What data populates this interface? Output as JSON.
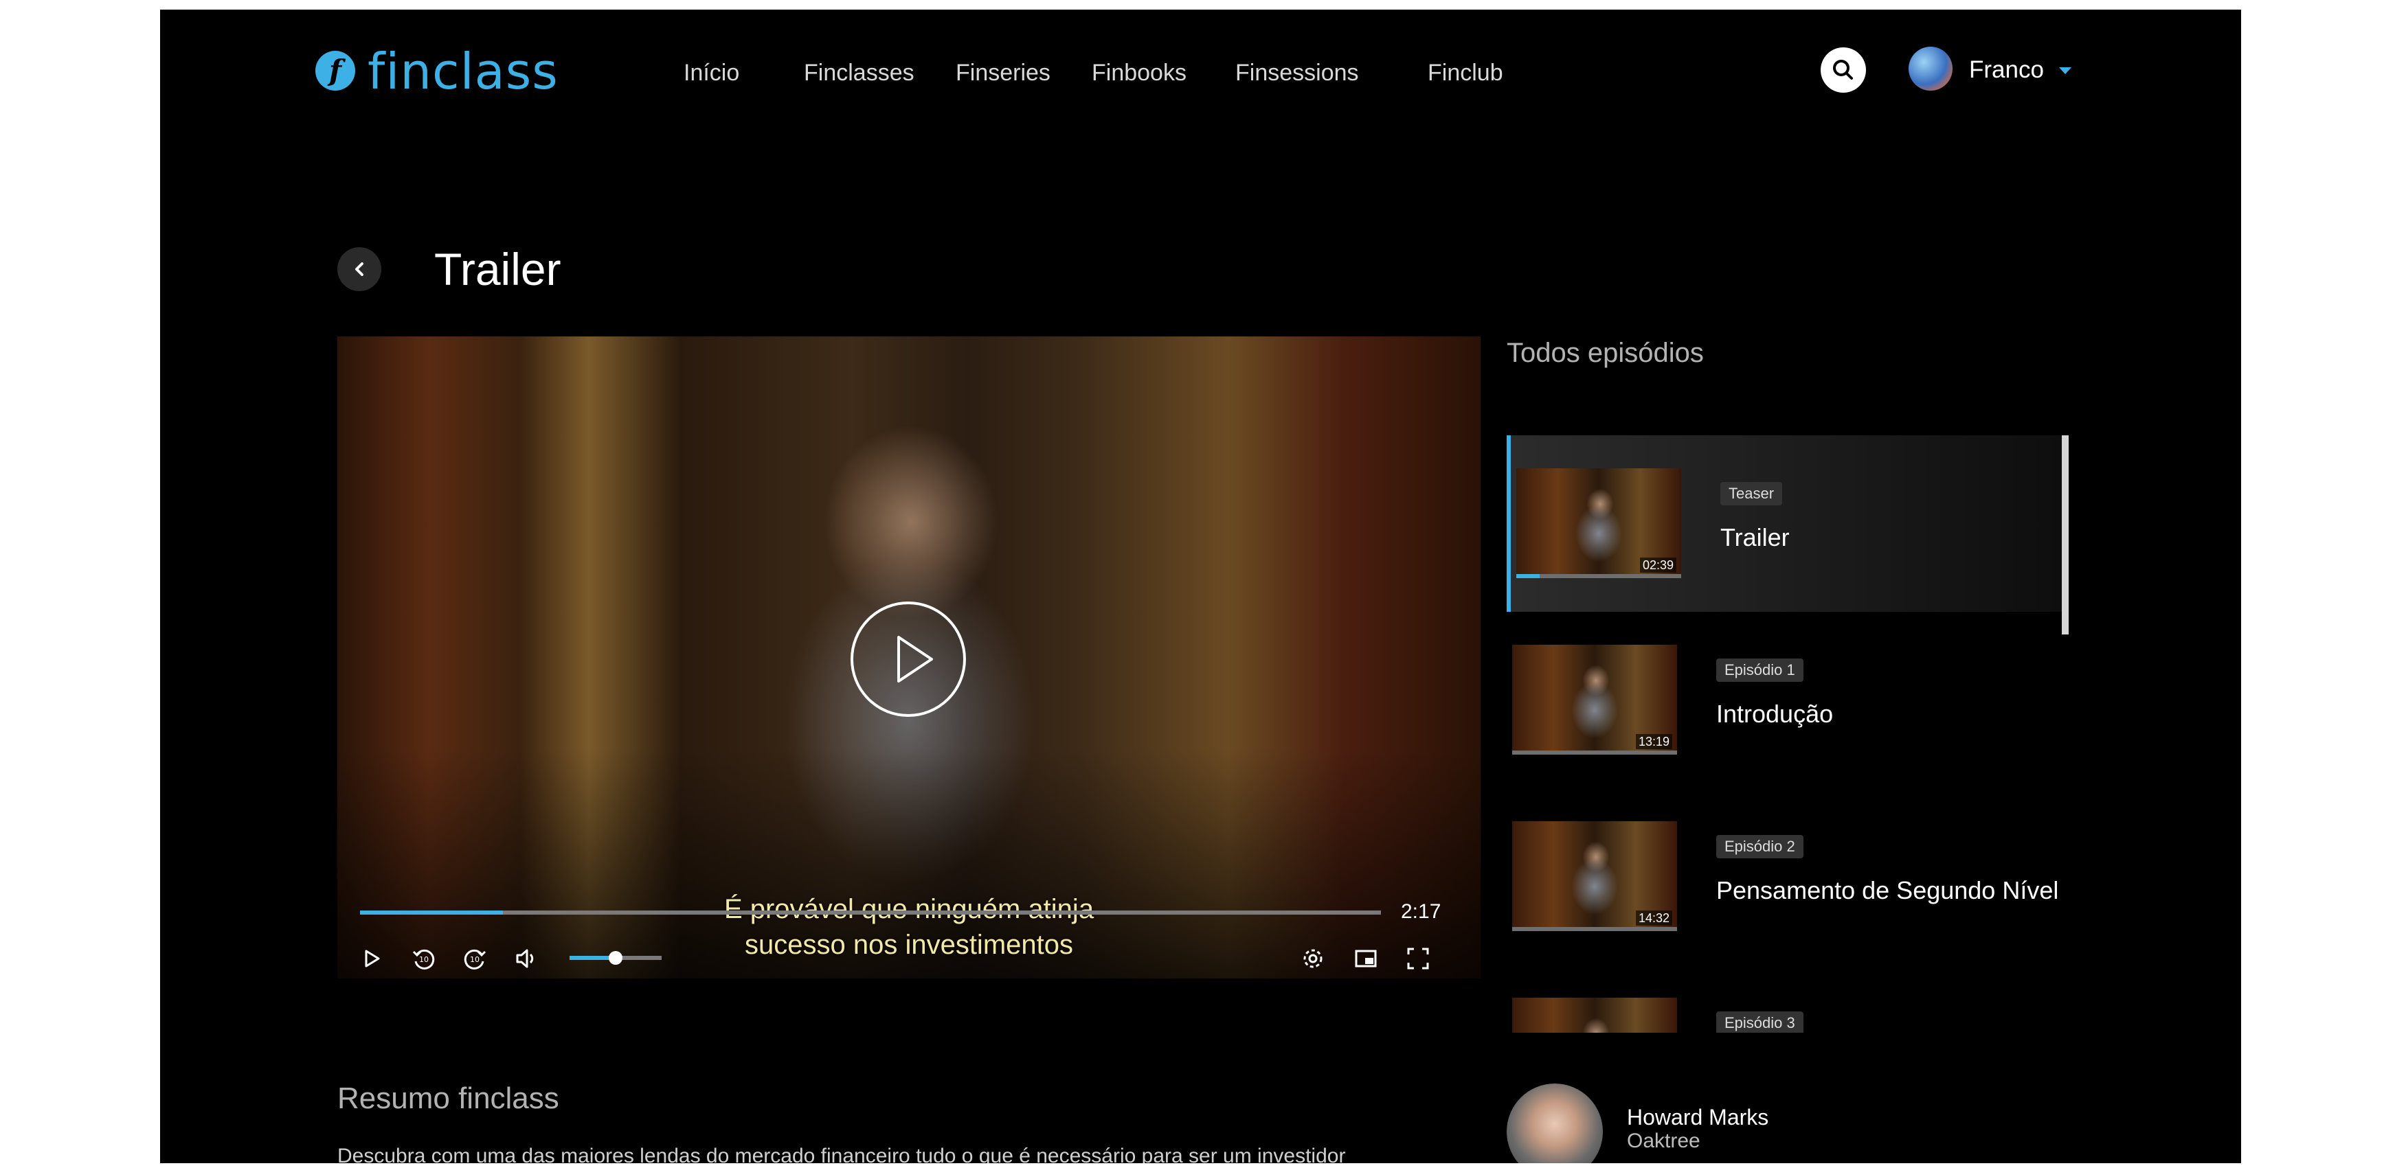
{
  "header": {
    "logo_text": "finclass",
    "logo_mark": "f",
    "nav": [
      "Início",
      "Finclasses",
      "Finseries",
      "Finbooks",
      "Finsessions",
      "Finclub"
    ],
    "search_icon": "search-icon",
    "user": {
      "name": "Franco"
    }
  },
  "page": {
    "title": "Trailer",
    "back_icon": "chevron-left-icon"
  },
  "player": {
    "subtitle_line1": "É provável que ninguém atinja",
    "subtitle_line2": "sucesso nos investimentos",
    "time_remaining": "2:17",
    "progress_fraction": 0.14,
    "volume_fraction": 0.5,
    "controls": [
      "play-icon",
      "rewind-10-icon",
      "forward-10-icon",
      "volume-icon",
      "settings-icon",
      "picture-in-picture-icon",
      "fullscreen-icon"
    ]
  },
  "episodes": {
    "heading": "Todos episódios",
    "items": [
      {
        "badge": "Teaser",
        "title": "Trailer",
        "duration": "02:39",
        "watched_fraction": 0.14,
        "active": true
      },
      {
        "badge": "Episódio 1",
        "title": "Introdução",
        "duration": "13:19",
        "watched_fraction": 0,
        "active": false
      },
      {
        "badge": "Episódio 2",
        "title": "Pensamento de Segundo Nível",
        "duration": "14:32",
        "watched_fraction": 0,
        "active": false
      },
      {
        "badge": "Episódio 3",
        "title": "",
        "duration": "",
        "watched_fraction": 0,
        "active": false
      }
    ]
  },
  "summary": {
    "title": "Resumo finclass",
    "text": "Descubra com uma das maiores lendas do mercado financeiro tudo o que é necessário para ser um investidor"
  },
  "author": {
    "name": "Howard Marks",
    "company": "Oaktree"
  },
  "colors": {
    "accent": "#3db0e6",
    "background": "#000000"
  }
}
